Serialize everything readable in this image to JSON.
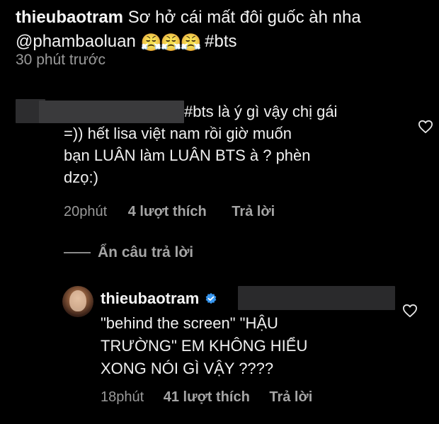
{
  "post": {
    "username": "thieubaotram",
    "caption_text": "Sơ hở cái mất đôi guốc àh nha",
    "mention": "@phambaoluan",
    "emojis": [
      "😤",
      "😤",
      "😤"
    ],
    "hashtag": "#bts",
    "time": "30 phút trước"
  },
  "comment1": {
    "text": "#bts là ý gì vậy chị gái\n=)) hết lisa việt nam rồi giờ muốn\nbạn LUÂN làm LUÂN BTS à ? phèn\ndzọ:)",
    "time": "20phút",
    "likes": "4 lượt thích",
    "reply": "Trả lời"
  },
  "hide_replies": "Ẩn câu trả lời",
  "reply1": {
    "username": "thieubaotram",
    "text": "\"behind the screen\" \"HẬU\nTRƯỜNG\" EM KHÔNG HIỂU\nXONG NÓI GÌ VẬY ????",
    "time": "18phút",
    "likes": "41 lượt thích",
    "reply": "Trả lời"
  },
  "icons": {
    "heart": "heart-outline-icon",
    "verified": "verified-badge-icon"
  },
  "colors": {
    "background": "#000000",
    "text": "#f2f2f2",
    "secondary": "#9a9a9a",
    "verified": "#3897f0"
  }
}
